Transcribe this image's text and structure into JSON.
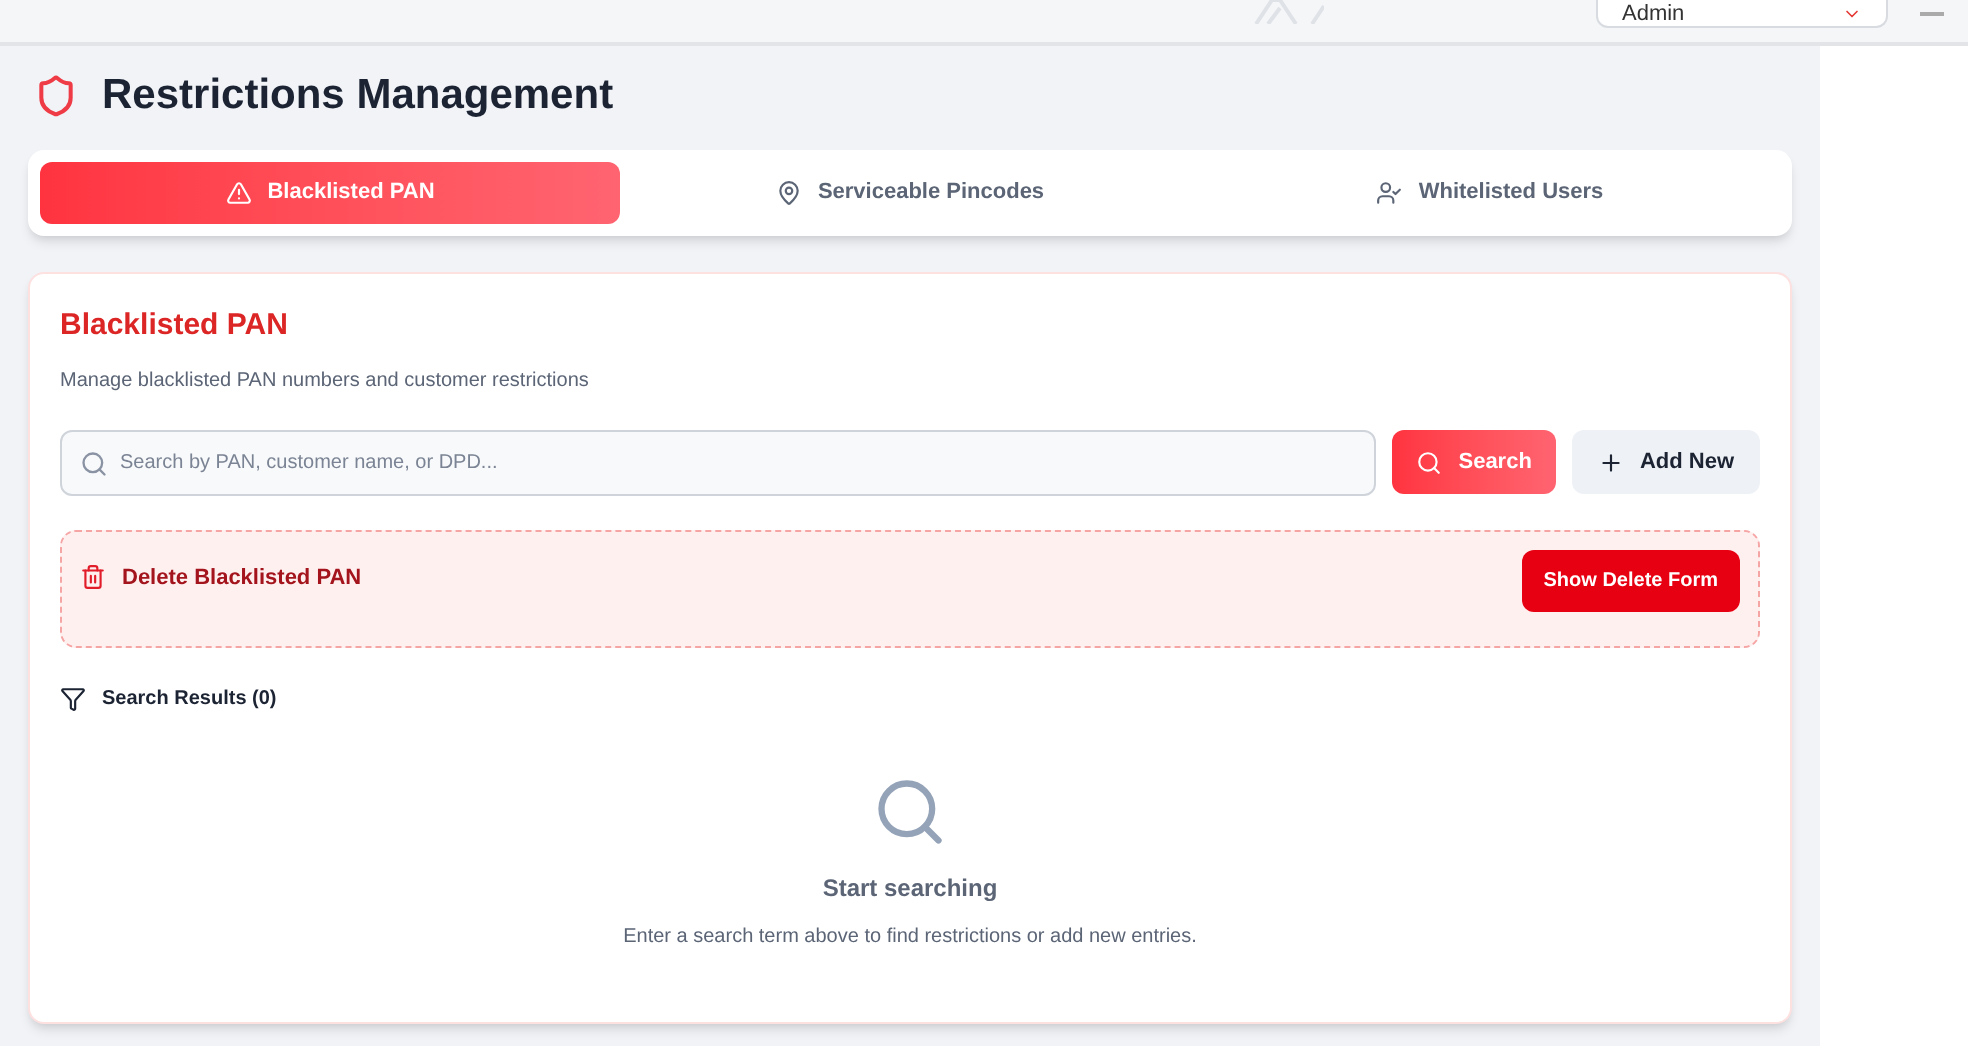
{
  "header": {
    "user_menu": {
      "label": "Admin"
    }
  },
  "page": {
    "title": "Restrictions Management"
  },
  "tabs": [
    {
      "label": "Blacklisted PAN",
      "selected": true
    },
    {
      "label": "Serviceable Pincodes",
      "selected": false
    },
    {
      "label": "Whitelisted Users",
      "selected": false
    }
  ],
  "panel": {
    "title": "Blacklisted PAN",
    "subtitle": "Manage blacklisted PAN numbers and customer restrictions",
    "search": {
      "placeholder": "Search by PAN, customer name, or DPD..."
    },
    "buttons": [
      {
        "label": "Search",
        "kind": "primary"
      },
      {
        "label": "Add New",
        "kind": "secondary"
      }
    ],
    "delete_section": {
      "title": "Delete Blacklisted PAN",
      "button": "Show Delete Form"
    },
    "results": {
      "label": "Search Results (0)"
    },
    "empty_state": {
      "title": "Start searching",
      "text": "Enter a search term above to find restrictions or add new entries."
    }
  }
}
